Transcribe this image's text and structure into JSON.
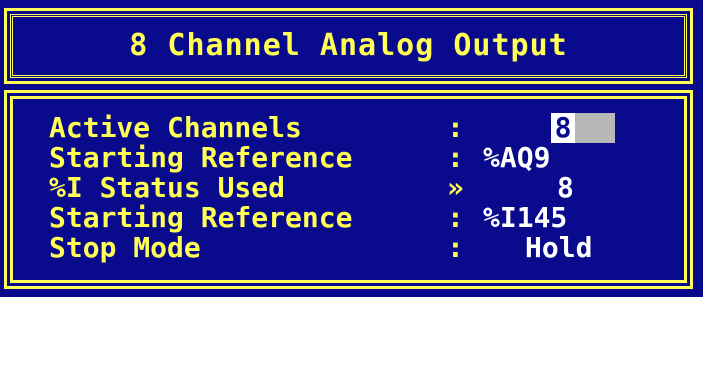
{
  "title": "8 Channel Analog Output",
  "fields": [
    {
      "label": "Active Channels",
      "sep": ":",
      "value": "8"
    },
    {
      "label": "Starting Reference",
      "sep": ":",
      "value": "%AQ9"
    },
    {
      "label": "%I Status Used",
      "sep": "»",
      "value": "8"
    },
    {
      "label": "Starting Reference",
      "sep": ":",
      "value": "%I145"
    },
    {
      "label": "Stop Mode",
      "sep": ":",
      "value": "Hold"
    }
  ],
  "colors": {
    "background": "#0a0a8c",
    "foreground": "#ffff54",
    "value": "#ffffff",
    "cursor": "#b8b8b8"
  }
}
